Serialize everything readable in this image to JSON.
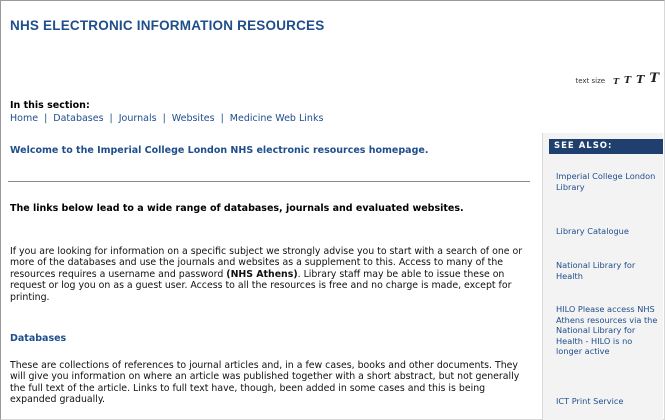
{
  "header": {
    "site_title": "NHS ELECTRONIC INFORMATION RESOURCES"
  },
  "text_size": {
    "label": "text size",
    "glyphs": [
      "T",
      "T",
      "T",
      "T"
    ]
  },
  "section": {
    "label": "In this section:",
    "nav": [
      "Home",
      "Databases",
      "Journals",
      "Websites",
      "Medicine Web Links"
    ],
    "separator": "|"
  },
  "main": {
    "welcome": "Welcome to the Imperial College London NHS electronic resources homepage.",
    "intro_bold": "The links below lead to a wide range of databases, journals and evaluated websites.",
    "para1_before": "If you are looking for information on a specific subject we strongly advise you to start with a search of one or more of the databases and use the journals and websites as a supplement to this. Access to many of the resources requires a username and password ",
    "para1_bold": "(NHS Athens)",
    "para1_after": ". Library staff may be able to issue these on request or log you on as a guest user. Access to all the resources is free and no charge is made, except for printing.",
    "databases_heading": "Databases",
    "para2": "These are collections of references to journal articles and, in a few cases, books and other documents. They will give you information on where an article was published together with a short abstract, but not generally the full text of the article. Links to full text have, though, been added in some cases and this is being expanded gradually."
  },
  "sidebar": {
    "header": "SEE ALSO:",
    "links": [
      "Imperial College London Library",
      "Library Catalogue",
      "National Library for Health",
      "HILO Please access NHS Athens resources via the National Library for Health - HILO is no longer active",
      "ICT Print Service"
    ]
  }
}
